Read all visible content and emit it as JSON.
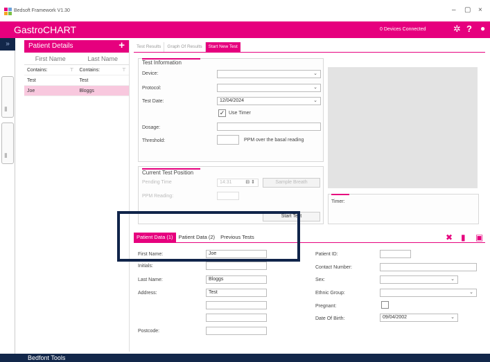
{
  "window": {
    "title": "Bedsoft Framework V1.30",
    "minimize": "–",
    "maximize": "▢",
    "close": "×"
  },
  "header": {
    "brand": "GastroCHART",
    "devices": "0 Devices Connected",
    "settings_icon": "gear-icon",
    "help": "?",
    "exit_icon": "close-circle-icon"
  },
  "patients": {
    "title": "Patient Details",
    "add": "+",
    "columns": [
      "First Name",
      "Last Name"
    ],
    "filter": [
      "Contains:",
      "Contains:"
    ],
    "rows": [
      {
        "first": "Test",
        "last": "Test",
        "selected": false
      },
      {
        "first": "Joe",
        "last": "Bloggs",
        "selected": true
      }
    ]
  },
  "top_tabs": [
    "Test Results",
    "Graph Of Results",
    "Start New Test"
  ],
  "test_info": {
    "title": "Test Information",
    "device_label": "Device:",
    "protocol_label": "Protocol:",
    "test_date_label": "Test Date:",
    "test_date_value": "12/04/2024",
    "use_timer_label": "Use Timer",
    "dosage_label": "Dosage:",
    "threshold_label": "Threshold:",
    "threshold_suffix": "PPM over the basal reading"
  },
  "position": {
    "title": "Current Test Position",
    "pending_label": "Pending Time",
    "time_value": "14:31",
    "sample_button": "Sample Breath",
    "ppm_label": "PPM Reading:"
  },
  "timer_label": "Timer:",
  "start_button": "Start Test",
  "bottom_tabs": [
    "Patient Data (1)",
    "Patient Data (2)",
    "Previous Tests"
  ],
  "patient_data": {
    "first_name_label": "First Name:",
    "first_name_value": "Joe",
    "initials_label": "Initials:",
    "last_name_label": "Last Name:",
    "last_name_value": "Bloggs",
    "address_label": "Address:",
    "address_value": "Test",
    "postcode_label": "Postcode:",
    "patient_id_label": "Patient ID:",
    "contact_label": "Contact Number:",
    "sex_label": "Sex:",
    "ethnic_label": "Ethnic Group:",
    "pregnant_label": "Pregnant:",
    "dob_label": "Date Of Birth:",
    "dob_value": "09/04/2002"
  },
  "actions": {
    "delete": "✖",
    "trash_icon": "trash-icon",
    "save_icon": "save-icon"
  },
  "footer": {
    "title": "Bedfont Tools"
  },
  "colors": {
    "accent": "#e6007e",
    "navy": "#12274a",
    "selected_row": "#f8c8de"
  }
}
